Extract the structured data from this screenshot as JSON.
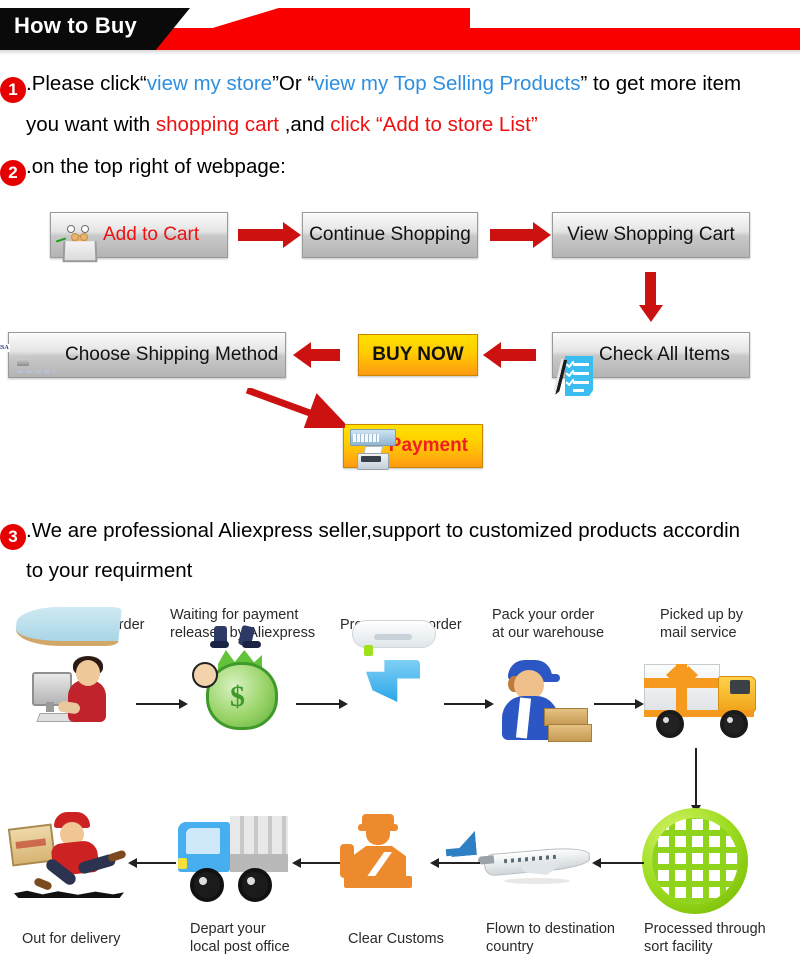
{
  "banner": {
    "title": "How to Buy",
    "black_color": "#0a0a0a",
    "red_color": "#fb0000"
  },
  "steps": [
    {
      "number": "1",
      "line1_parts": [
        {
          "text": ".Please click“",
          "color": "black"
        },
        {
          "text": "view my store",
          "color": "blue"
        },
        {
          "text": "”Or “",
          "color": "black"
        },
        {
          "text": "view my Top Selling Products",
          "color": "blue"
        },
        {
          "text": "” to get more item",
          "color": "black"
        }
      ],
      "line2_parts": [
        {
          "text": "you want with ",
          "color": "black"
        },
        {
          "text": "shopping cart",
          "color": "red"
        },
        {
          "text": " ,and ",
          "color": "black"
        },
        {
          "text": "click “Add to store List”",
          "color": "red"
        }
      ]
    },
    {
      "number": "2",
      "line1_parts": [
        {
          "text": ".on the top right of webpage:",
          "color": "black"
        }
      ]
    },
    {
      "number": "3",
      "line1_parts": [
        {
          "text": ".We are professional Aliexpress seller,support to customized products accordin",
          "color": "black"
        }
      ],
      "line2_parts": [
        {
          "text": "to your requirment",
          "color": "black"
        }
      ]
    }
  ],
  "flowchart": {
    "buttons": [
      {
        "id": "add-cart",
        "label": "Add to Cart",
        "icon": "shopping-cart-icon",
        "label_color": "#ee1111",
        "style": "grey"
      },
      {
        "id": "continue",
        "label": "Continue Shopping",
        "icon": "none",
        "label_color": "#111111",
        "style": "grey"
      },
      {
        "id": "view-cart",
        "label": "View Shopping Cart",
        "icon": "none",
        "label_color": "#111111",
        "style": "grey"
      },
      {
        "id": "check-items",
        "label": "Check All Items",
        "icon": "checklist-icon",
        "label_color": "#111111",
        "style": "grey"
      },
      {
        "id": "buy-now",
        "label": "BUY NOW",
        "icon": "none",
        "label_color": "#111111",
        "style": "gold"
      },
      {
        "id": "shipping",
        "label": "Choose Shipping Method",
        "icon": "credit-card-icon",
        "label_color": "#111111",
        "style": "grey"
      },
      {
        "id": "payment",
        "label": "Payment",
        "icon": "cash-register-icon",
        "label_color": "#ee2222",
        "style": "gold"
      }
    ],
    "arrow_color": "#cc1111"
  },
  "shipping_flow": {
    "top_row": [
      {
        "label": "Receive your order",
        "icon": "person-at-computer-icon"
      },
      {
        "label": "Waiting for payment\nreleased by Aliexpress",
        "icon": "money-bag-icon"
      },
      {
        "label": "Prepare your order",
        "icon": "download-box-icon"
      },
      {
        "label": "Pack your order\nat our warehouse",
        "icon": "warehouse-worker-icon"
      },
      {
        "label": "Picked up by\nmail service",
        "icon": "gift-truck-icon"
      }
    ],
    "bottom_row": [
      {
        "label": "Out for delivery",
        "icon": "running-courier-icon"
      },
      {
        "label": "Depart your\nlocal post office",
        "icon": "post-truck-icon"
      },
      {
        "label": "Clear Customs",
        "icon": "customs-officer-icon"
      },
      {
        "label": "Flown to destination\ncountry",
        "icon": "airplane-icon"
      },
      {
        "label": "Processed through\nsort facility",
        "icon": "green-globe-icon"
      }
    ],
    "arrow_color": "#222222"
  }
}
